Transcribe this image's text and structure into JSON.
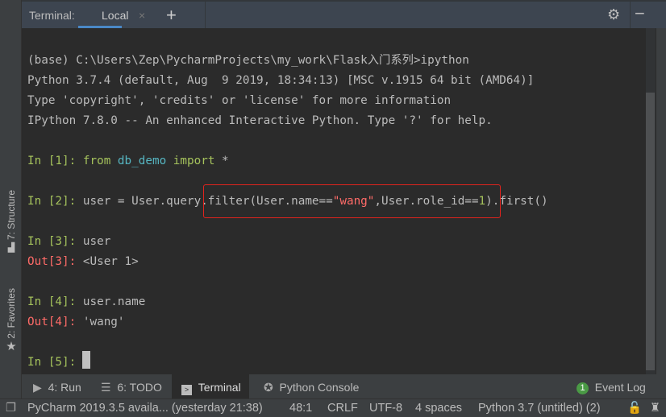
{
  "header": {
    "title": "Terminal:",
    "tab": "Local",
    "close": "×",
    "add": "+",
    "settings_icon": "gear-icon",
    "minimize_icon": "minus-icon"
  },
  "sidebar": {
    "structure": "7: Structure",
    "favorites": "2: Favorites"
  },
  "terminal": {
    "lines": [
      {
        "text": "(base) C:\\Users\\Zep\\PycharmProjects\\my_work\\Flask入门系列>ipython"
      },
      {
        "text": "Python 3.7.4 (default, Aug  9 2019, 18:34:13) [MSC v.1915 64 bit (AMD64)]"
      },
      {
        "text": "Type 'copyright', 'credits' or 'license' for more information"
      },
      {
        "text": "IPython 7.8.0 -- An enhanced Interactive Python. Type '?' for help."
      }
    ],
    "in1": {
      "prompt": "In [1]: ",
      "kw1": "from ",
      "mod": "db_demo",
      "kw2": " import",
      "rest": " *"
    },
    "in2": {
      "prompt": "In [2]: ",
      "a": "user = User.query.filter(User.name==",
      "str": "\"wang\"",
      "b": ",User.role_id==",
      "num": "1",
      "c": ").first()"
    },
    "in3": {
      "prompt": "In [3]: ",
      "code": "user"
    },
    "out3": {
      "prompt": "Out[3]: ",
      "value": "<User 1>"
    },
    "in4": {
      "prompt": "In [4]: ",
      "code": "user.name"
    },
    "out4": {
      "prompt": "Out[4]: ",
      "value": "'wang'"
    },
    "in5": {
      "prompt": "In [5]: "
    }
  },
  "toolwindows": [
    {
      "label": "4: Run",
      "icon": "play-icon"
    },
    {
      "label": "6: TODO",
      "icon": "list-icon"
    },
    {
      "label": "Terminal",
      "icon": "terminal-icon",
      "active": true
    },
    {
      "label": "Python Console",
      "icon": "python-icon"
    }
  ],
  "event_log": {
    "count": "1",
    "label": "Event Log"
  },
  "status": {
    "message": "PyCharm 2019.3.5 availa... (yesterday 21:38)",
    "position": "48:1",
    "line_sep": "CRLF",
    "encoding": "UTF-8",
    "indent": "4 spaces",
    "interpreter": "Python 3.7 (untitled) (2)"
  },
  "colors": {
    "highlight_box": "#e0231d",
    "prompt_in": "#a5c25c",
    "prompt_out": "#ff6b68"
  }
}
